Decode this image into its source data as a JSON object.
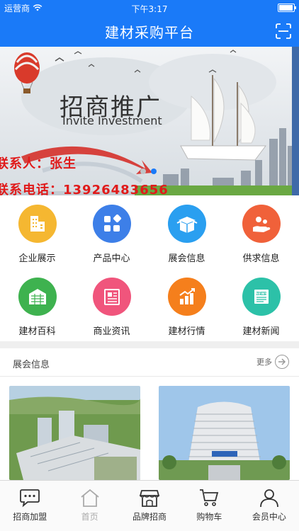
{
  "status_bar": {
    "carrier": "运营商",
    "time": "下午3:17",
    "battery_level": 0.95
  },
  "nav": {
    "title": "建材采购平台",
    "scan_icon": "scan-icon"
  },
  "banner": {
    "title": "招商推广",
    "subtitle": "Invite Investment",
    "contact_person": "联系人：张生",
    "contact_phone": "联系电话：13926483656",
    "page_count": 2,
    "active_page": 2
  },
  "menu": [
    {
      "label": "企业展示",
      "icon": "building-icon",
      "color": "#f5b731"
    },
    {
      "label": "产品中心",
      "icon": "grid-icon",
      "color": "#3d7fe8"
    },
    {
      "label": "展会信息",
      "icon": "box-icon",
      "color": "#2a9ff0"
    },
    {
      "label": "供求信息",
      "icon": "hand-coins-icon",
      "color": "#f0613a"
    },
    {
      "label": "建材百科",
      "icon": "warehouse-icon",
      "color": "#3eb24f"
    },
    {
      "label": "商业资讯",
      "icon": "newspaper-icon",
      "color": "#f0557c"
    },
    {
      "label": "建材行情",
      "icon": "bar-chart-icon",
      "color": "#f57f1c"
    },
    {
      "label": "建材新闻",
      "icon": "news-icon",
      "color": "#2cc1a8"
    }
  ],
  "section": {
    "title": "展会信息",
    "more_label": "更多"
  },
  "tabs": [
    {
      "label": "招商加盟",
      "icon": "chat-icon",
      "active": true
    },
    {
      "label": "首页",
      "icon": "home-icon",
      "active": false
    },
    {
      "label": "品牌招商",
      "icon": "shop-icon",
      "active": true
    },
    {
      "label": "购物车",
      "icon": "cart-icon",
      "active": true
    },
    {
      "label": "会员中心",
      "icon": "user-icon",
      "active": true
    }
  ],
  "colors": {
    "primary": "#1a7af8",
    "contact_red": "#e01a1a"
  }
}
